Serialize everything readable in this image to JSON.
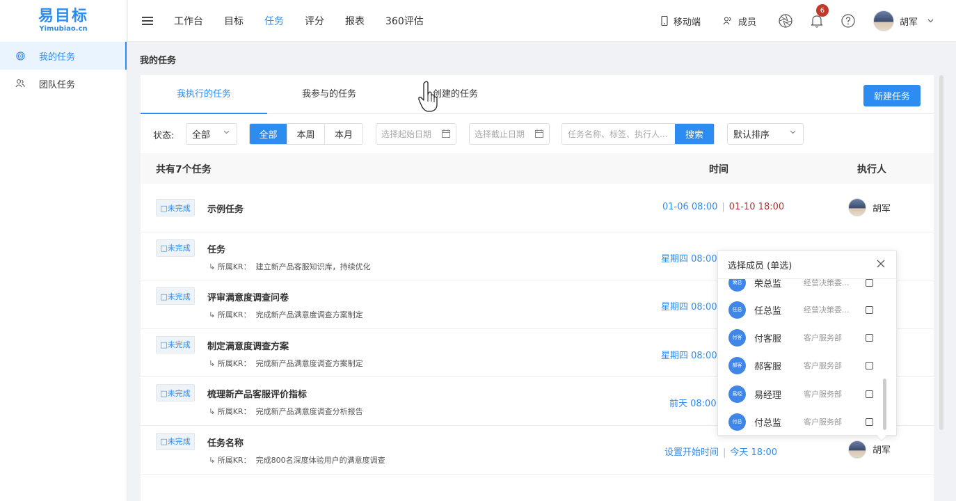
{
  "logo": {
    "main": "易目标",
    "sub": "Yimubiao.cn"
  },
  "sidebar": {
    "items": [
      {
        "label": "我的任务",
        "icon": "target-icon",
        "active": true
      },
      {
        "label": "团队任务",
        "icon": "team-icon",
        "active": false
      }
    ]
  },
  "nav": {
    "items": [
      "工作台",
      "目标",
      "任务",
      "评分",
      "报表",
      "360评估"
    ],
    "active": "任务"
  },
  "topright": {
    "mobile": "移动端",
    "members": "成员",
    "bell_count": "6",
    "user": "胡军"
  },
  "breadcrumb": "我的任务",
  "tabs": {
    "mine": "我执行的任务",
    "joined": "我参与的任务",
    "created": "创建的任务",
    "new_task": "新建任务"
  },
  "filters": {
    "status_label": "状态:",
    "status_value": "全部",
    "range": [
      "全部",
      "本周",
      "本月"
    ],
    "start_placeholder": "选择起始日期",
    "end_placeholder": "选择截止日期",
    "search_placeholder": "任务名称、标签、执行人...",
    "search_button": "搜索",
    "sort_value": "默认排序"
  },
  "table": {
    "count": "共有7个任务",
    "col_time": "时间",
    "col_owner": "执行人"
  },
  "tasks": [
    {
      "status": "□未完成",
      "title": "示例任务",
      "kr": "",
      "time_start": "01-06 08:00",
      "time_end": "01-10 18:00",
      "owner": "胡军"
    },
    {
      "status": "□未完成",
      "title": "任务",
      "kr_label": "所属KR：",
      "kr": "建立新产品客服知识库，持续优化",
      "time_start": "星期四 08:00"
    },
    {
      "status": "□未完成",
      "title": "评审满意度调查问卷",
      "kr_label": "所属KR：",
      "kr": "完成新产品满意度调查方案制定",
      "time_start": "星期四 08:00"
    },
    {
      "status": "□未完成",
      "title": "制定满意度调查方案",
      "kr_label": "所属KR：",
      "kr": "完成新产品满意度调查方案制定",
      "time_start": "星期四 08:00"
    },
    {
      "status": "□未完成",
      "title": "梳理新产品客服评价指标",
      "kr_label": "所属KR：",
      "kr": "完成新产品满意度调查分析报告",
      "time_start": "前天 08:00"
    },
    {
      "status": "□未完成",
      "title": "任务名称",
      "kr_label": "所属KR：",
      "kr": "完成800名深度体验用户的满意度调查",
      "time_start": "设置开始时间",
      "time_end": "今天 18:00",
      "owner": "胡军"
    }
  ],
  "popup": {
    "title": "选择成员 (单选)",
    "members": [
      {
        "avatar": "荣总",
        "name": "荣总监",
        "dept": "经营决策委..."
      },
      {
        "avatar": "任总",
        "name": "任总监",
        "dept": "经营决策委..."
      },
      {
        "avatar": "付客",
        "name": "付客服",
        "dept": "客户服务部"
      },
      {
        "avatar": "郝客",
        "name": "郝客服",
        "dept": "客户服务部"
      },
      {
        "avatar": "易经",
        "name": "易经理",
        "dept": "客户服务部"
      },
      {
        "avatar": "付总",
        "name": "付总监",
        "dept": "客户服务部"
      }
    ]
  },
  "colors": {
    "accent": "#2d8cf0",
    "overdue": "#aa3333",
    "badge": "#c0392b"
  }
}
